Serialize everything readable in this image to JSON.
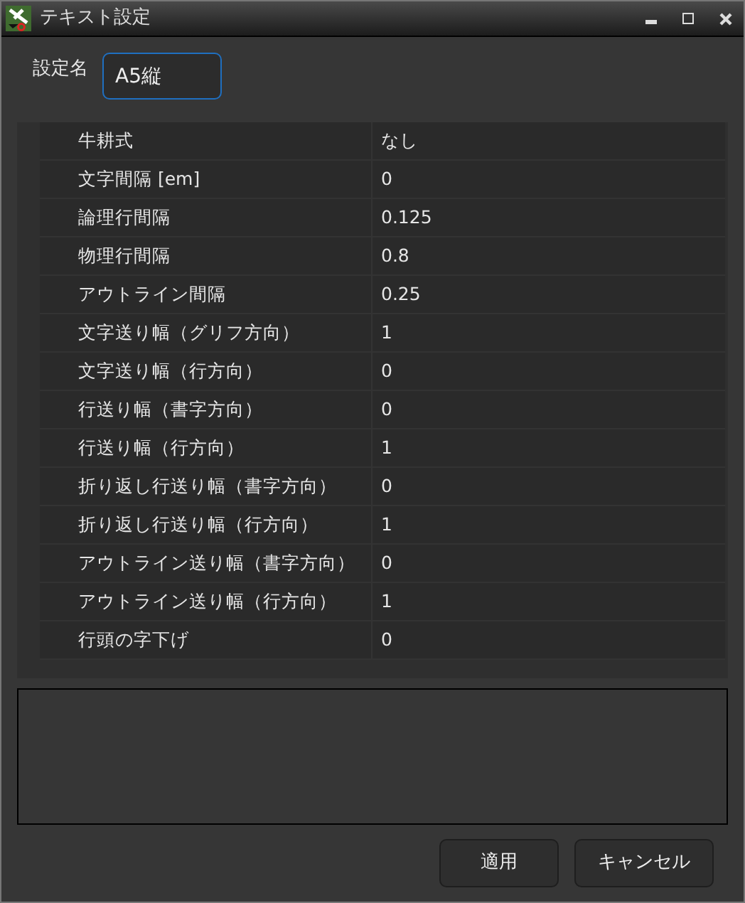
{
  "window": {
    "title": "テキスト設定"
  },
  "name_field": {
    "label": "設定名",
    "value": "A5縦"
  },
  "properties": [
    {
      "name": "牛耕式",
      "value": "なし"
    },
    {
      "name": "文字間隔 [em]",
      "value": "0"
    },
    {
      "name": "論理行間隔",
      "value": "0.125"
    },
    {
      "name": "物理行間隔",
      "value": "0.8"
    },
    {
      "name": "アウトライン間隔",
      "value": "0.25"
    },
    {
      "name": "文字送り幅（グリフ方向）",
      "value": "1"
    },
    {
      "name": "文字送り幅（行方向）",
      "value": "0"
    },
    {
      "name": "行送り幅（書字方向）",
      "value": "0"
    },
    {
      "name": "行送り幅（行方向）",
      "value": "1"
    },
    {
      "name": "折り返し行送り幅（書字方向）",
      "value": "0"
    },
    {
      "name": "折り返し行送り幅（行方向）",
      "value": "1"
    },
    {
      "name": "アウトライン送り幅（書字方向）",
      "value": "0"
    },
    {
      "name": "アウトライン送り幅（行方向）",
      "value": "1"
    },
    {
      "name": "行頭の字下げ",
      "value": "0"
    }
  ],
  "buttons": [
    "適用",
    "キャンセル"
  ]
}
